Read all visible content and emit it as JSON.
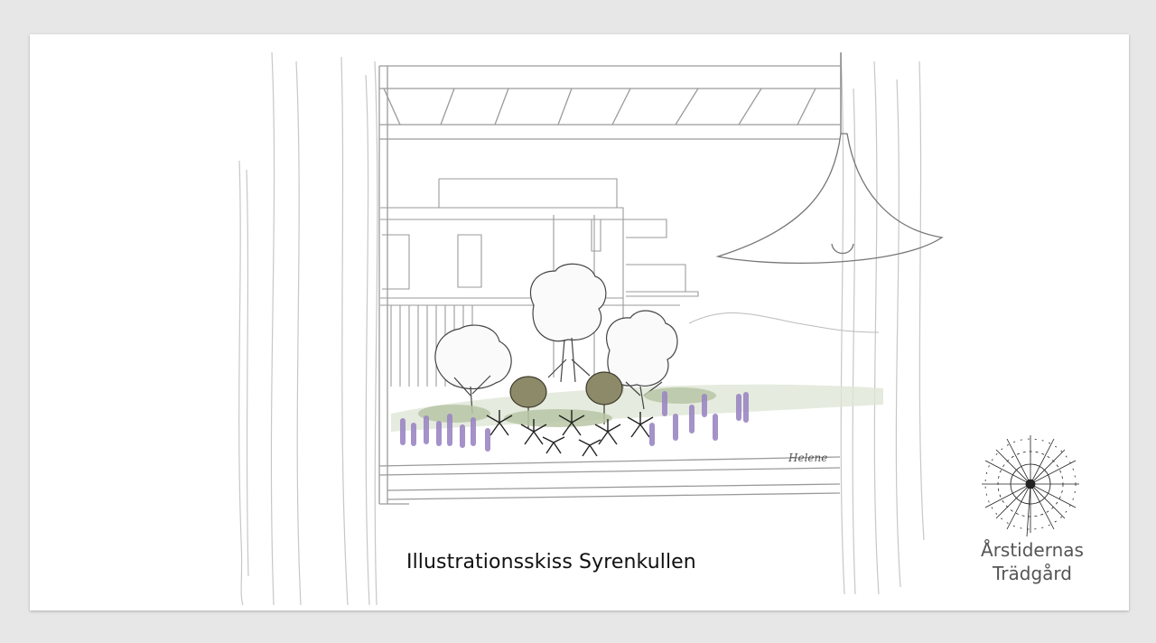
{
  "caption": "Illustrationsskiss Syrenkullen",
  "brand": {
    "line1": "Årstidernas",
    "line2": "Trädgård",
    "logo_icon": "dandelion-logo-icon"
  },
  "signature": "Helene",
  "colors": {
    "background": "#e7e7e7",
    "card": "#ffffff",
    "line": "#8a8a8a",
    "lavender": "#9b87c4",
    "foliage": "#a8b894",
    "tree_crown": "#8d8a6a"
  }
}
